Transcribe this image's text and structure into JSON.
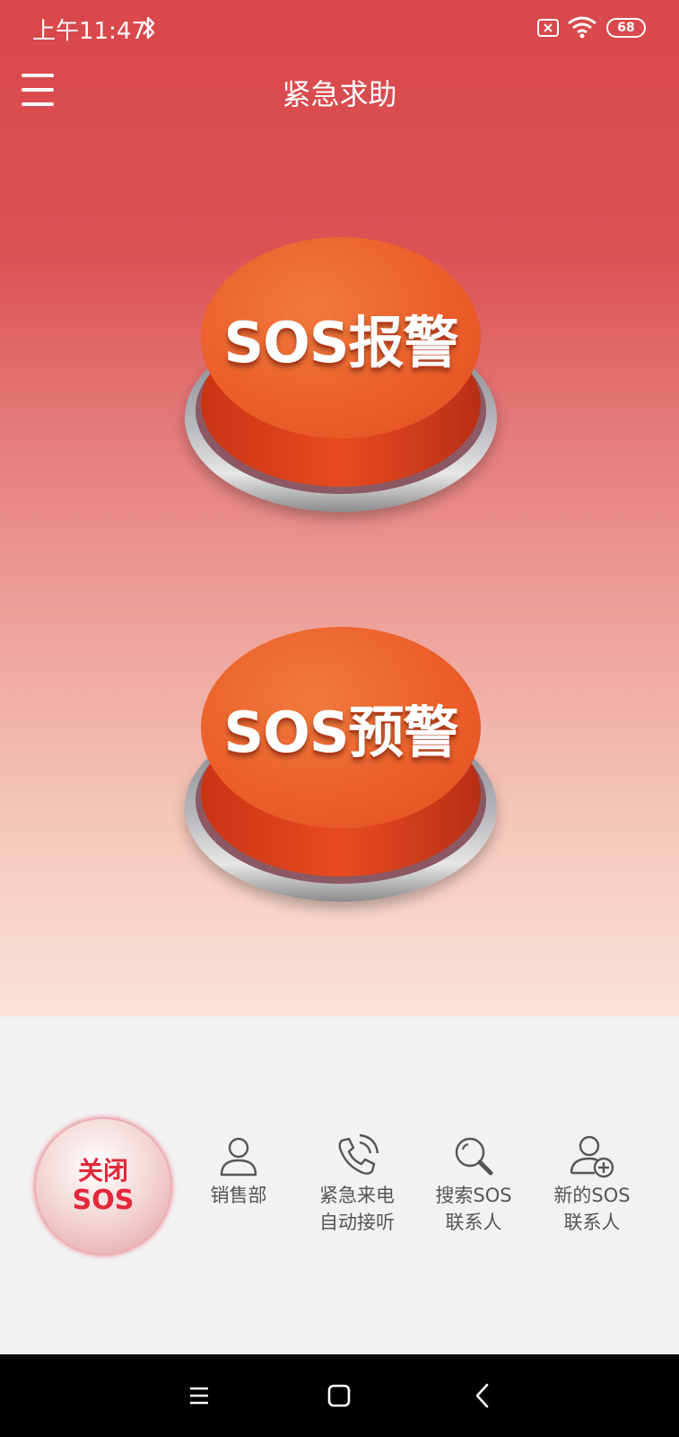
{
  "status_bar": {
    "time": "上午11:47",
    "battery": "68"
  },
  "header": {
    "title": "紧急求助",
    "menu_icon": "hamburger-menu-icon"
  },
  "buttons": {
    "sos_alarm": "SOS报警",
    "sos_warning": "SOS预警"
  },
  "bottom": {
    "close_sos_line1": "关闭",
    "close_sos_line2": "SOS",
    "tools": [
      {
        "icon": "person-icon",
        "line1": "销售部",
        "line2": ""
      },
      {
        "icon": "phone-call-icon",
        "line1": "紧急来电",
        "line2": "自动接听"
      },
      {
        "icon": "search-icon",
        "line1": "搜索SOS",
        "line2": "联系人"
      },
      {
        "icon": "add-person-icon",
        "line1": "新的SOS",
        "line2": "联系人"
      }
    ]
  },
  "colors": {
    "primary_red": "#d9474b",
    "button_orange": "#ec5f2a",
    "close_text": "#e3283a"
  }
}
